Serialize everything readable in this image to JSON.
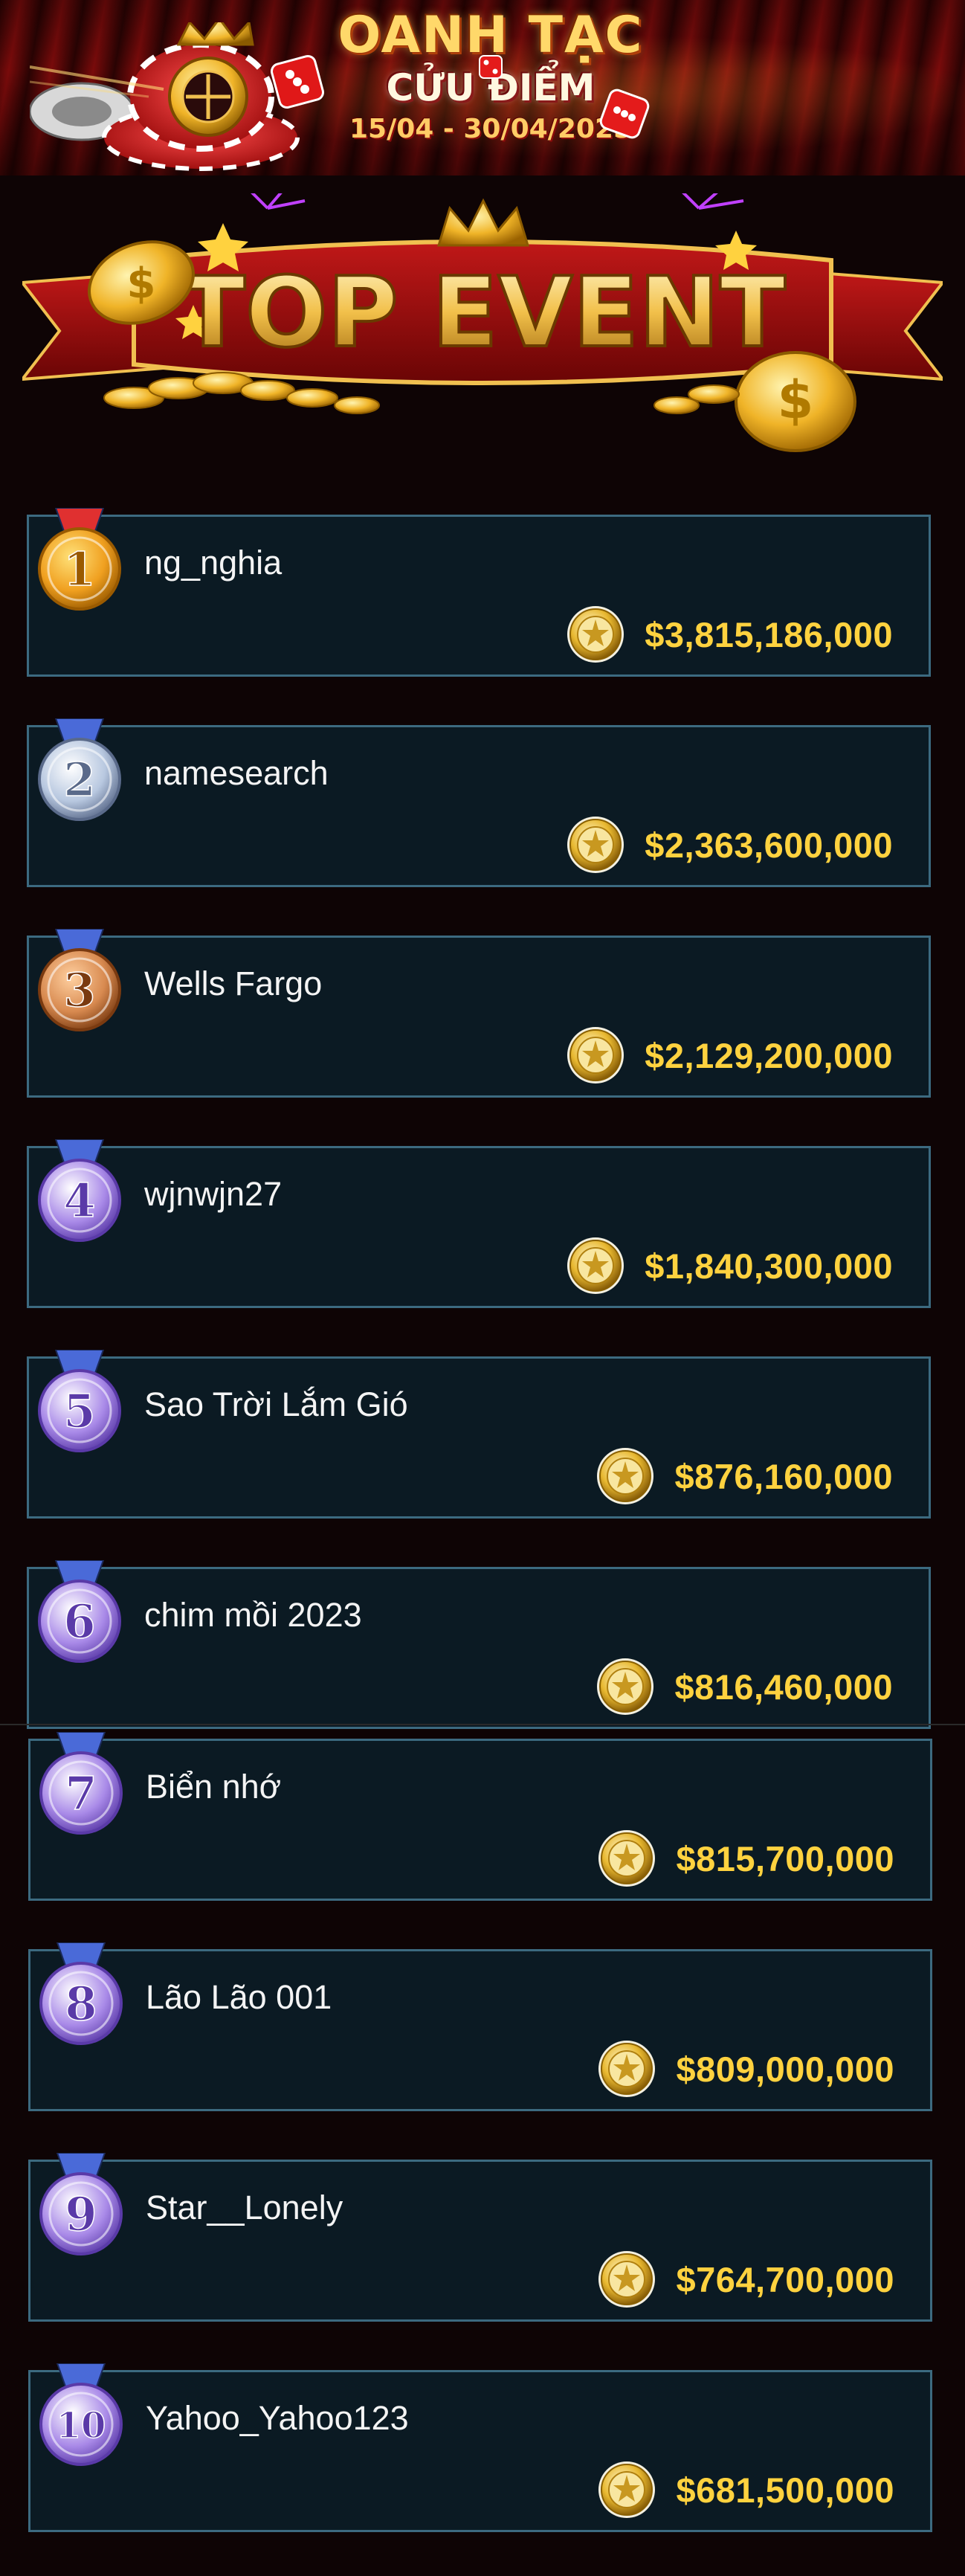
{
  "banner": {
    "title_line1": "OANH TẠC",
    "title_line2": "CỬU ĐIỂM",
    "dates": "15/04 - 30/04/2025"
  },
  "event": {
    "title": "TOP EVENT"
  },
  "colors": {
    "background": "#0e0405",
    "row_background": "#0b1a23",
    "row_border": "#3c6a80",
    "prize_text": "#ffd23f",
    "name_text": "#f4f4f4",
    "gold_medal": "#f0a020",
    "silver_medal": "#b8c8e0",
    "bronze_medal": "#d88a50",
    "purple_medal": "#a98ae8"
  },
  "leaderboard": [
    {
      "rank": "1",
      "name": "ng_nghia",
      "amount": "$3,815,186,000",
      "medal": "gold-medal-icon"
    },
    {
      "rank": "2",
      "name": "namesearch",
      "amount": "$2,363,600,000",
      "medal": "silver-medal-icon"
    },
    {
      "rank": "3",
      "name": "Wells Fargo",
      "amount": "$2,129,200,000",
      "medal": "bronze-medal-icon"
    },
    {
      "rank": "4",
      "name": "wjnwjn27",
      "amount": "$1,840,300,000",
      "medal": "purple-medal-icon"
    },
    {
      "rank": "5",
      "name": "Sao Trời Lắm Gió",
      "amount": "$876,160,000",
      "medal": "purple-medal-icon"
    },
    {
      "rank": "6",
      "name": "chim mồi 2023",
      "amount": "$816,460,000",
      "medal": "purple-medal-icon"
    },
    {
      "rank": "7",
      "name": "Biển nhớ",
      "amount": "$815,700,000",
      "medal": "purple-medal-icon"
    },
    {
      "rank": "8",
      "name": "Lão Lão 001",
      "amount": "$809,000,000",
      "medal": "purple-medal-icon"
    },
    {
      "rank": "9",
      "name": "Star__Lonely",
      "amount": "$764,700,000",
      "medal": "purple-medal-icon"
    },
    {
      "rank": "10",
      "name": "Yahoo_Yahoo123",
      "amount": "$681,500,000",
      "medal": "purple-medal-icon"
    }
  ]
}
